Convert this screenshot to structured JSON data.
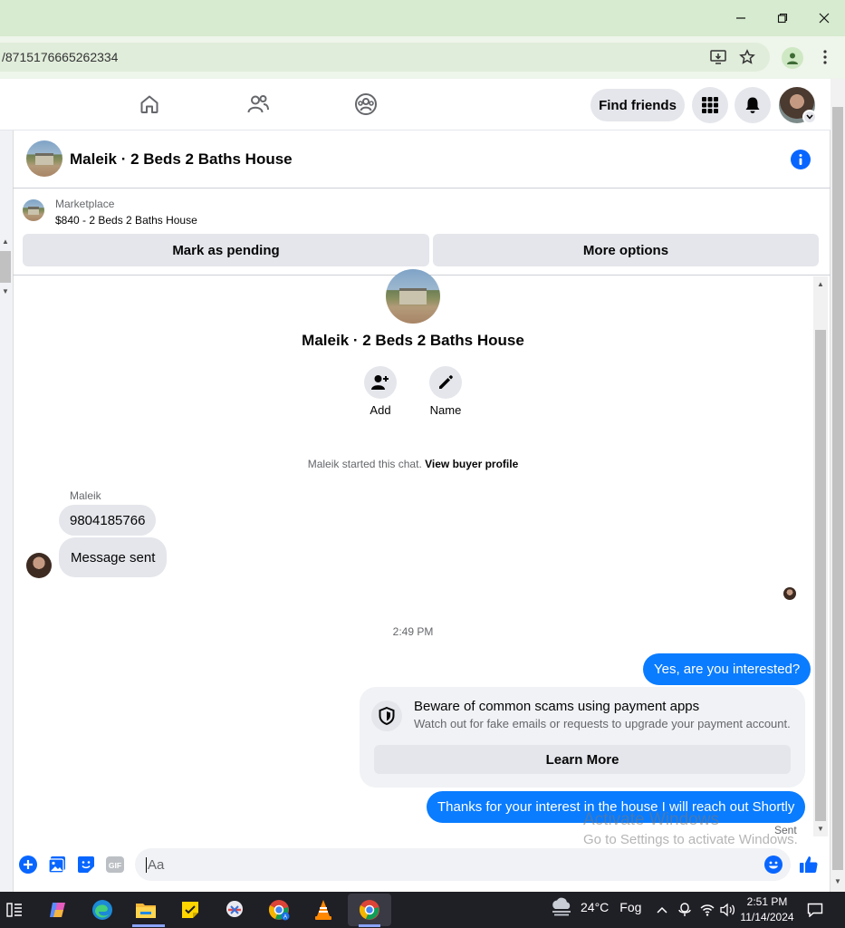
{
  "browser": {
    "url": "/8715176665262334"
  },
  "fbnav": {
    "find_friends_label": "Find friends"
  },
  "chat": {
    "title": "Maleik · 2 Beds 2 Baths House",
    "marketplace_label": "Marketplace",
    "listing_line": "$840 - 2 Beds 2 Baths House",
    "mark_pending_label": "Mark as pending",
    "more_options_label": "More options",
    "center_title": "Maleik · 2 Beds 2 Baths House",
    "add_label": "Add",
    "name_label": "Name",
    "started_text": "Maleik started this chat.",
    "view_buyer_label": "View buyer profile",
    "sender_name": "Maleik",
    "incoming": [
      "9804185766",
      "Message sent"
    ],
    "timestamp": "2:49 PM",
    "outgoing_1": "Yes, are you interested?",
    "scam_title": "Beware of common scams using payment apps",
    "scam_desc": "Watch out for fake emails or requests to upgrade your payment account.",
    "learn_more_label": "Learn More",
    "outgoing_2": "Thanks for your interest in the house I will reach out Shortly",
    "sent_label": "Sent"
  },
  "composer": {
    "placeholder": "Aa"
  },
  "watermark": {
    "line1": "Activate Windows",
    "line2": "Go to Settings to activate Windows."
  },
  "taskbar": {
    "weather_temp": "24°C",
    "weather_desc": "Fog",
    "time": "2:51 PM",
    "date": "11/14/2024"
  },
  "colors": {
    "messenger_blue": "#0a7cff",
    "fb_blue": "#0866ff"
  }
}
